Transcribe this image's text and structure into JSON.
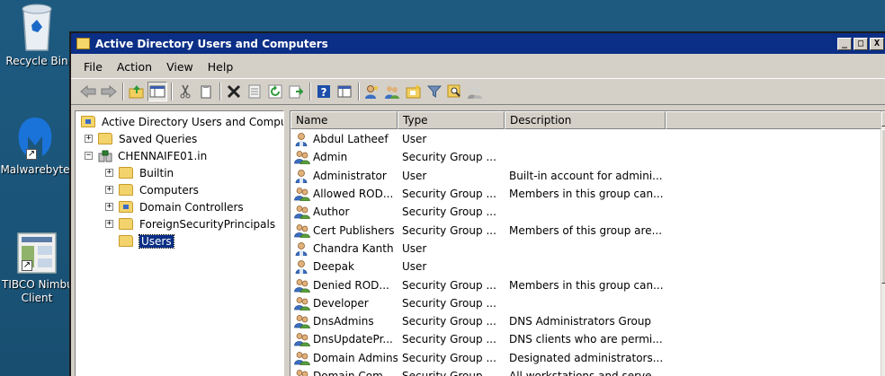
{
  "desktop": {
    "icons": [
      {
        "name": "recycle-bin",
        "label": "Recycle Bin"
      },
      {
        "name": "malwarebytes",
        "label": "Malwarebyte"
      },
      {
        "name": "tibco",
        "label_line1": "TIBCO Nimbu",
        "label_line2": "Client"
      }
    ]
  },
  "window": {
    "title": "Active Directory Users and Computers",
    "buttons": {
      "minimize": "_",
      "maximize": "□",
      "close": "X"
    }
  },
  "menu": [
    "File",
    "Action",
    "View",
    "Help"
  ],
  "toolbar": {
    "icons": [
      "back-icon",
      "forward-icon",
      "up-folder-icon",
      "show-console-tree-icon",
      "cut-icon",
      "copy-icon",
      "delete-icon",
      "properties-icon",
      "refresh-icon",
      "export-list-icon",
      "help-icon",
      "console-icon",
      "new-user-icon",
      "new-group-icon",
      "new-ou-icon",
      "filter-icon",
      "find-icon",
      "add-to-group-icon"
    ]
  },
  "tree": {
    "root": "Active Directory Users and Comput",
    "items": [
      {
        "label": "Saved Queries",
        "level": 1,
        "expander": "+"
      },
      {
        "label": "CHENNAIFE01.in",
        "level": 1,
        "expander": "−"
      },
      {
        "label": "Builtin",
        "level": 2,
        "expander": "+"
      },
      {
        "label": "Computers",
        "level": 2,
        "expander": "+"
      },
      {
        "label": "Domain Controllers",
        "level": 2,
        "expander": "+"
      },
      {
        "label": "ForeignSecurityPrincipals",
        "level": 2,
        "expander": "+"
      },
      {
        "label": "Users",
        "level": 2,
        "expander": ""
      }
    ]
  },
  "list": {
    "columns": [
      "Name",
      "Type",
      "Description"
    ],
    "rows": [
      {
        "name": "Abdul Latheef",
        "type": "User",
        "description": "",
        "kind": "user"
      },
      {
        "name": "Admin",
        "type": "Security Group ...",
        "description": "",
        "kind": "group"
      },
      {
        "name": "Administrator",
        "type": "User",
        "description": "Built-in account for admini...",
        "kind": "user"
      },
      {
        "name": "Allowed ROD...",
        "type": "Security Group ...",
        "description": "Members in this group can...",
        "kind": "group"
      },
      {
        "name": "Author",
        "type": "Security Group ...",
        "description": "",
        "kind": "group"
      },
      {
        "name": "Cert Publishers",
        "type": "Security Group ...",
        "description": "Members of this group are...",
        "kind": "group"
      },
      {
        "name": "Chandra Kanth",
        "type": "User",
        "description": "",
        "kind": "user"
      },
      {
        "name": "Deepak",
        "type": "User",
        "description": "",
        "kind": "user"
      },
      {
        "name": "Denied ROD...",
        "type": "Security Group ...",
        "description": "Members in this group can...",
        "kind": "group"
      },
      {
        "name": "Developer",
        "type": "Security Group ...",
        "description": "",
        "kind": "group"
      },
      {
        "name": "DnsAdmins",
        "type": "Security Group ...",
        "description": "DNS Administrators Group",
        "kind": "group"
      },
      {
        "name": "DnsUpdatePr...",
        "type": "Security Group ...",
        "description": "DNS clients who are permi...",
        "kind": "group"
      },
      {
        "name": "Domain Admins",
        "type": "Security Group ...",
        "description": "Designated administrators...",
        "kind": "group"
      },
      {
        "name": "Domain Com...",
        "type": "Security Group ...",
        "description": "All workstations and serve...",
        "kind": "group"
      }
    ]
  }
}
